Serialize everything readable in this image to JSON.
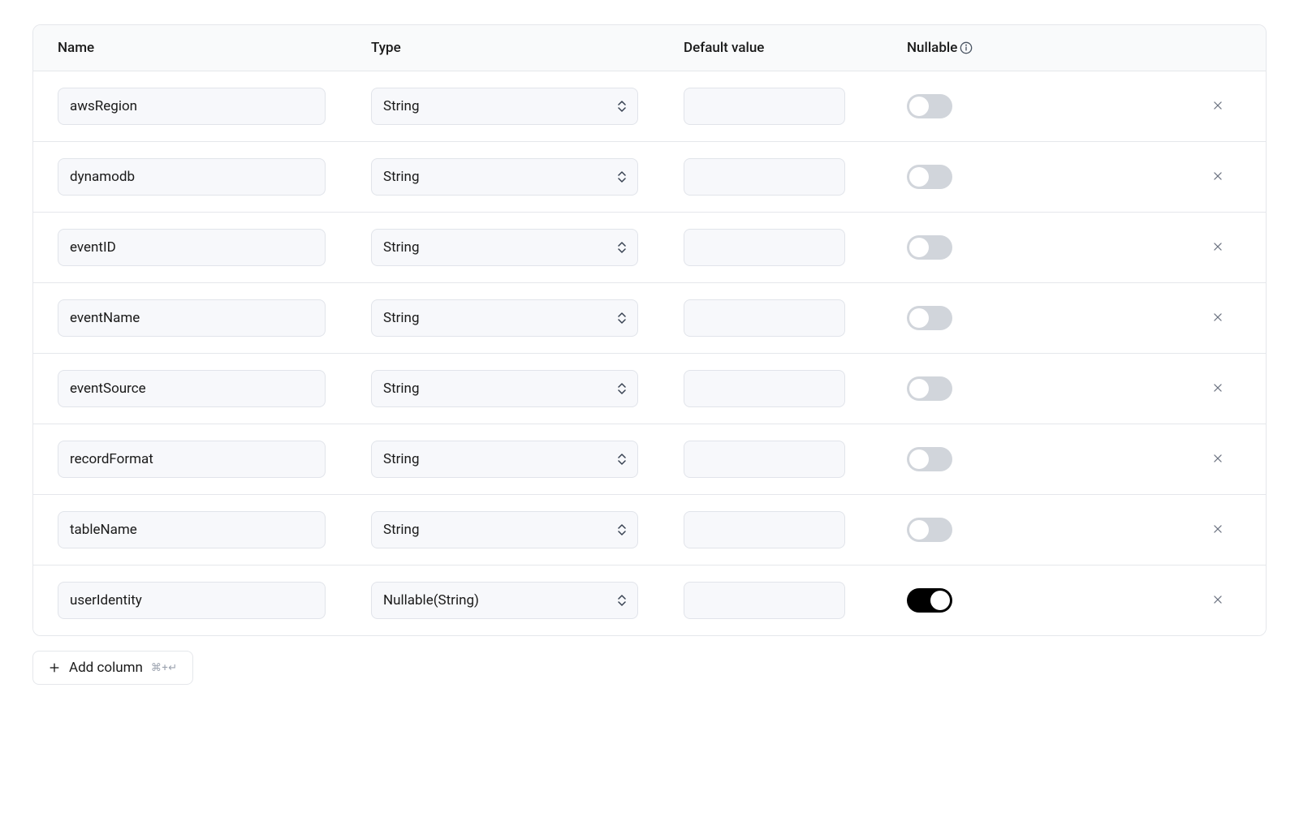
{
  "headers": {
    "name": "Name",
    "type": "Type",
    "default_value": "Default value",
    "nullable": "Nullable"
  },
  "columns": [
    {
      "name": "awsRegion",
      "type": "String",
      "default": "",
      "nullable": false
    },
    {
      "name": "dynamodb",
      "type": "String",
      "default": "",
      "nullable": false
    },
    {
      "name": "eventID",
      "type": "String",
      "default": "",
      "nullable": false
    },
    {
      "name": "eventName",
      "type": "String",
      "default": "",
      "nullable": false
    },
    {
      "name": "eventSource",
      "type": "String",
      "default": "",
      "nullable": false
    },
    {
      "name": "recordFormat",
      "type": "String",
      "default": "",
      "nullable": false
    },
    {
      "name": "tableName",
      "type": "String",
      "default": "",
      "nullable": false
    },
    {
      "name": "userIdentity",
      "type": "Nullable(String)",
      "default": "",
      "nullable": true
    }
  ],
  "add_column": {
    "label": "Add column",
    "shortcut": "⌘+↵"
  }
}
